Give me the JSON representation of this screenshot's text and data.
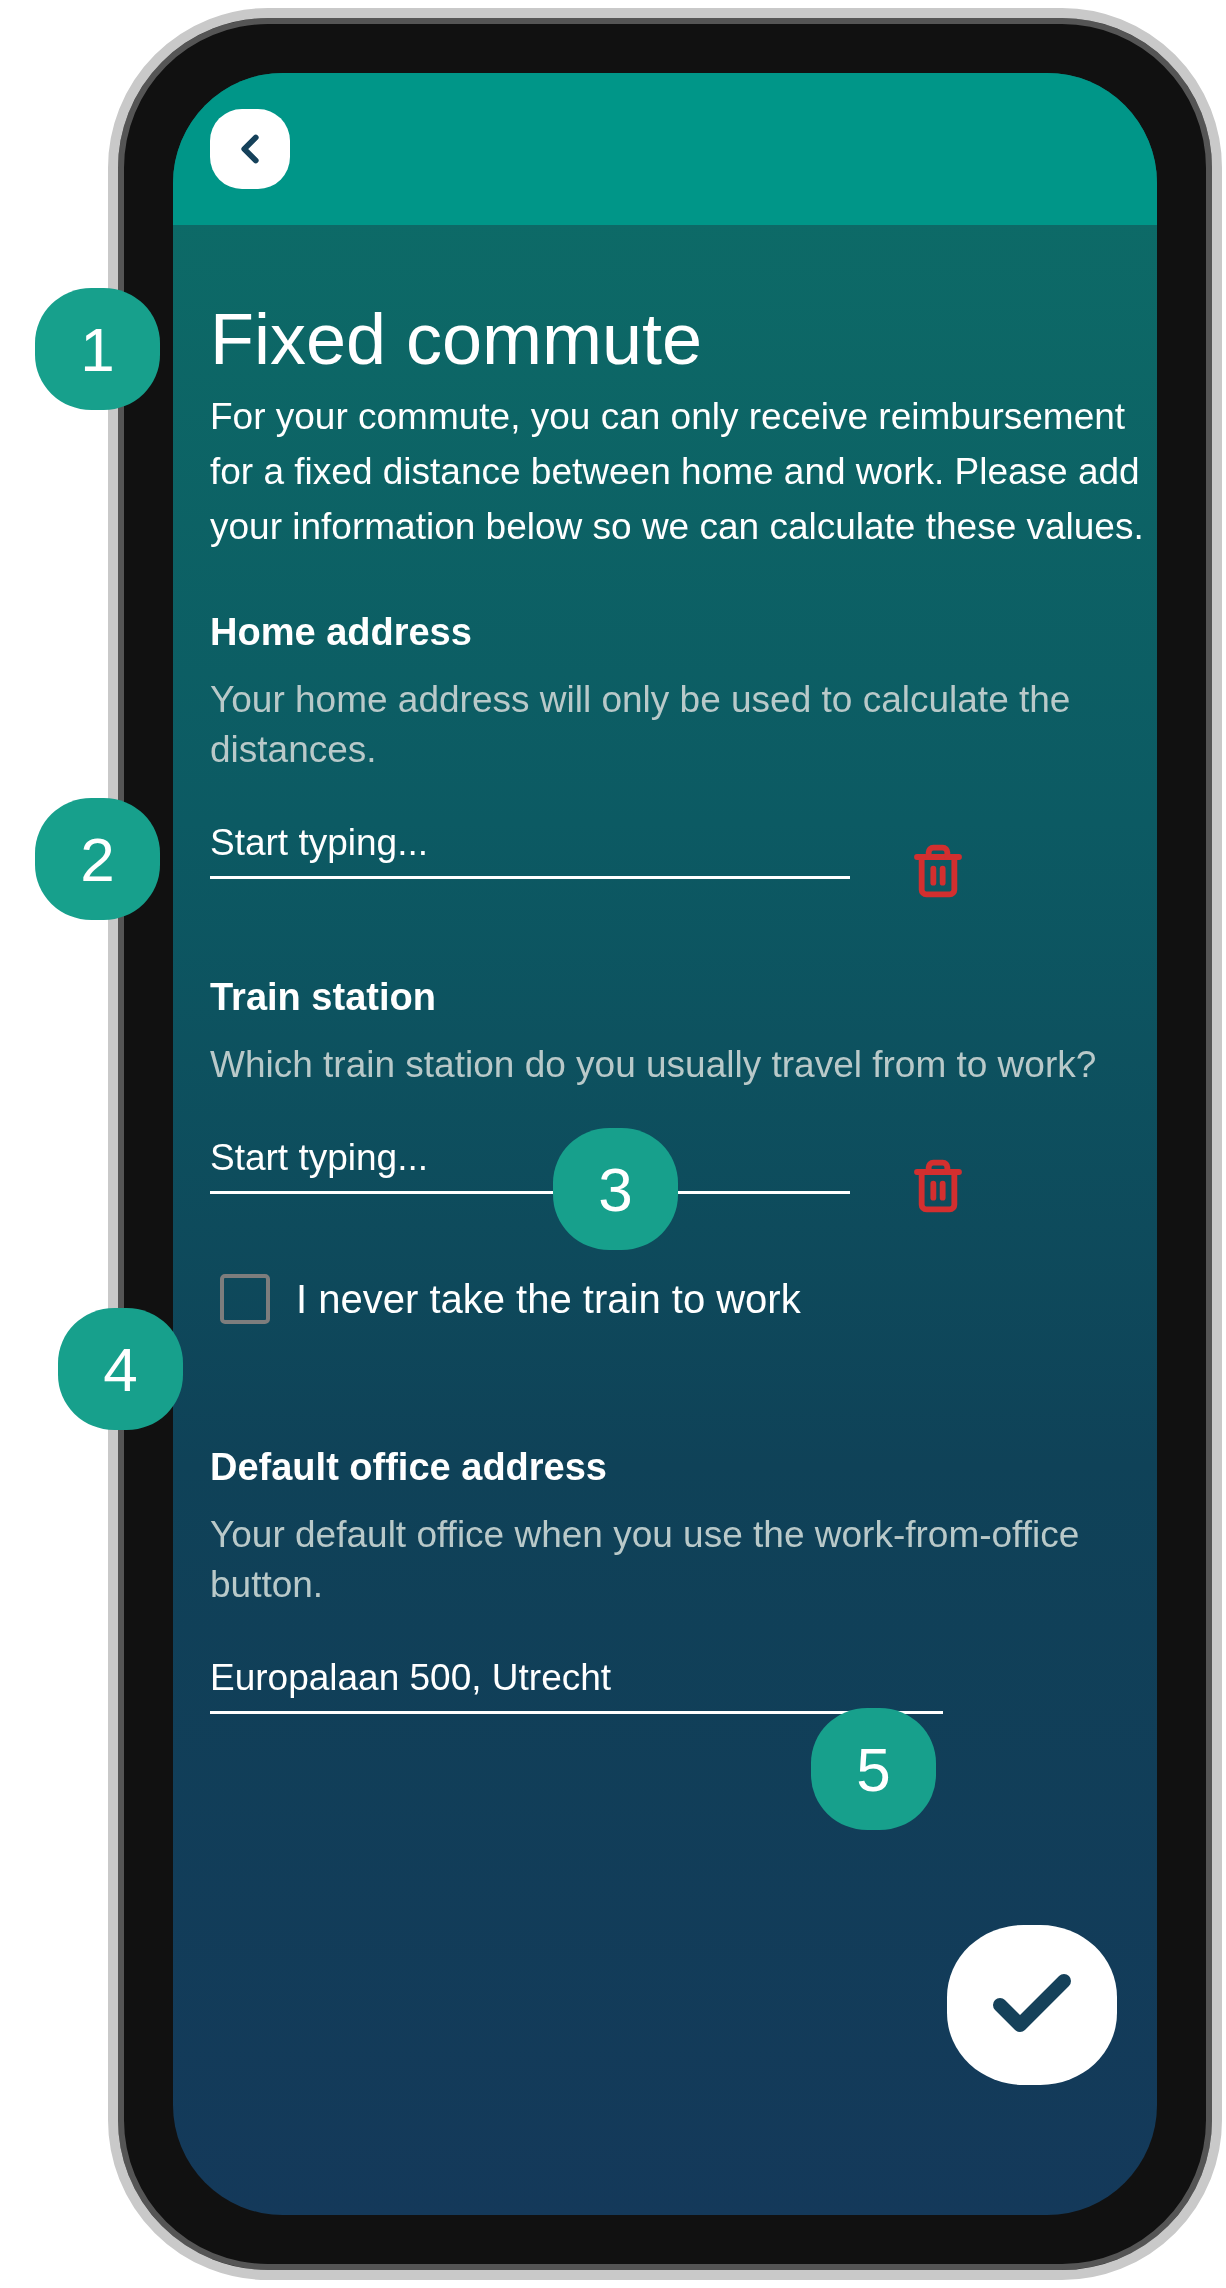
{
  "screen": {
    "title": "Fixed commute",
    "intro": "For your commute, you can only receive reimbursement for a fixed distance between home and work. Please add your information below so we can calculate these values.",
    "sections": [
      {
        "kind": "field",
        "label": "Home address",
        "hint": "Your home address will only be used to calculate the distances.",
        "placeholder": "Start typing...",
        "deletable": true
      },
      {
        "kind": "field",
        "label": "Train station",
        "hint": "Which train station do you usually travel from to work?",
        "placeholder": "Start typing...",
        "deletable": true
      },
      {
        "kind": "checkbox",
        "label": "I never take the train to work",
        "checked": false
      },
      {
        "kind": "field",
        "label": "Default office address",
        "hint": "Your default office when you use the work-from-office button.",
        "value": "Europalaan 500, Utrecht",
        "deletable": false
      }
    ]
  },
  "callouts": [
    "1",
    "2",
    "3",
    "4",
    "5"
  ]
}
